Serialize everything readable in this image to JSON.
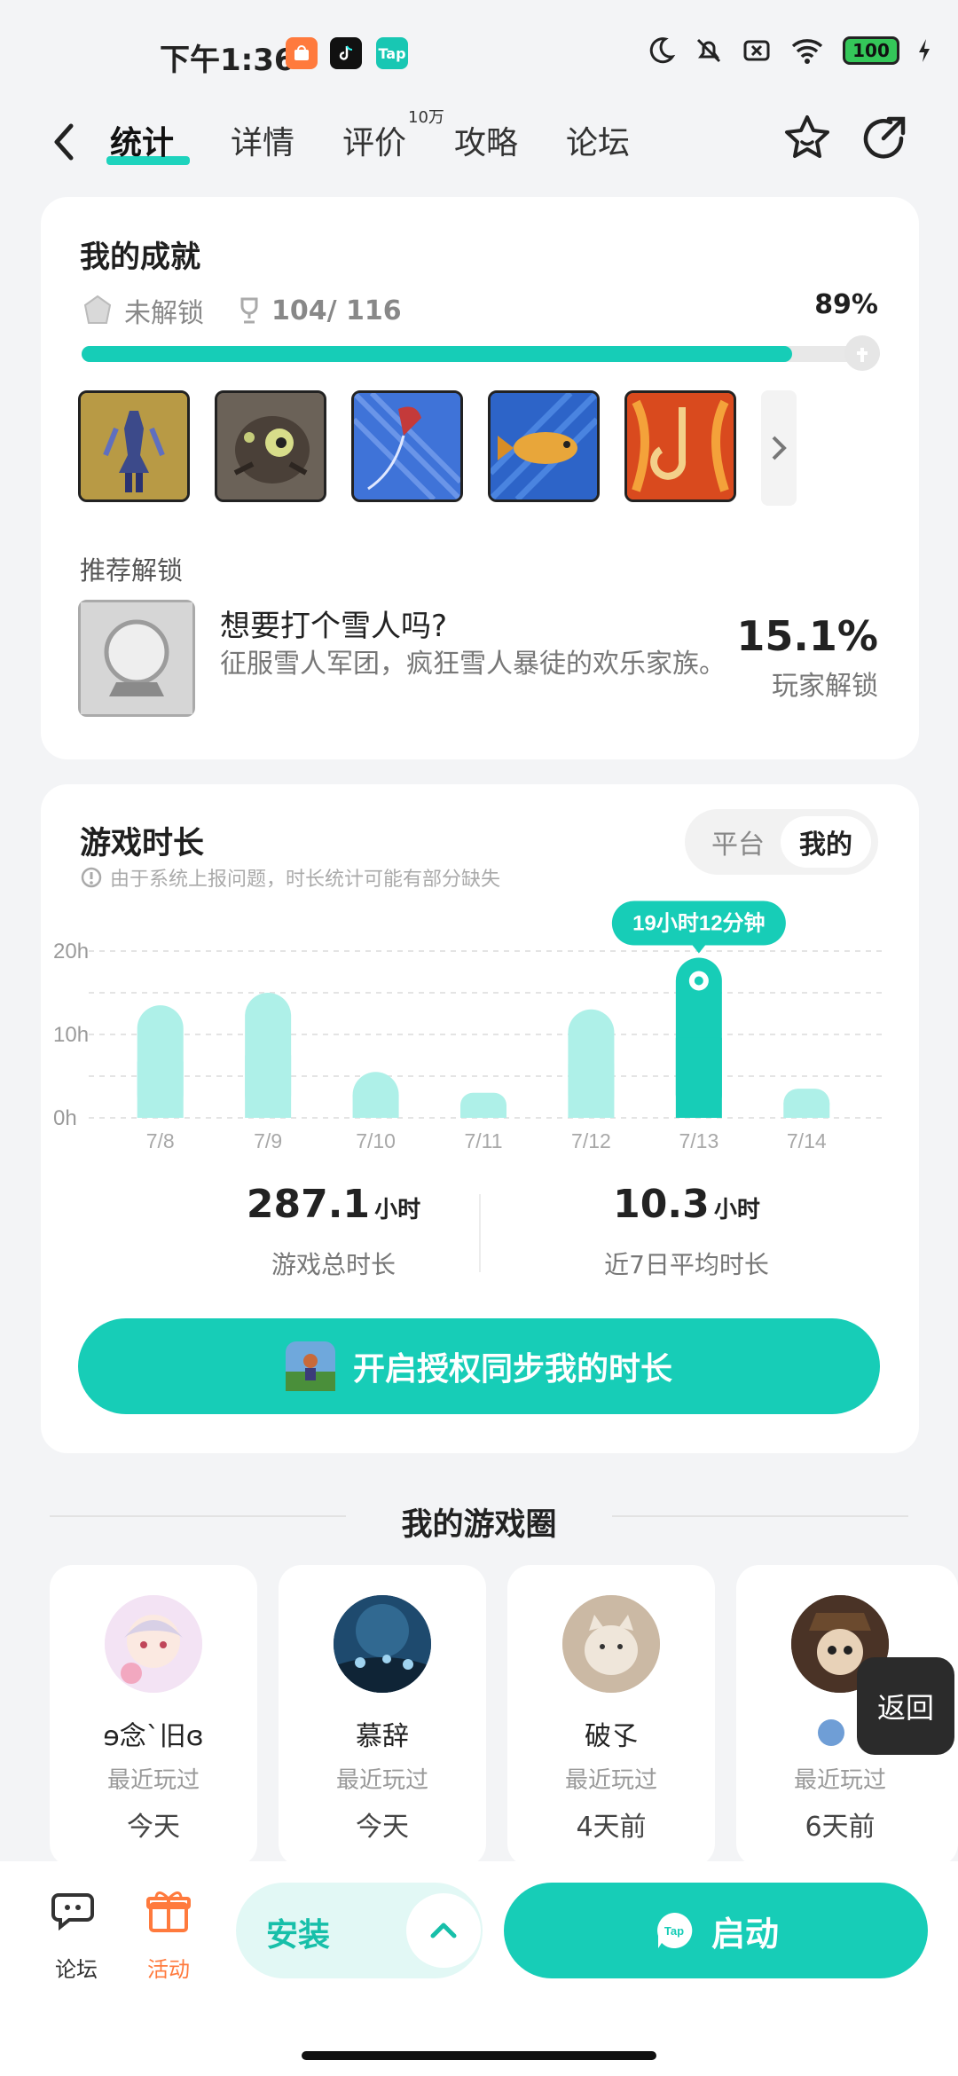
{
  "status": {
    "time": "下午1:36",
    "battery": "100",
    "app_tap": "Tap"
  },
  "nav": {
    "tabs": [
      "统计",
      "详情",
      "评价",
      "攻略",
      "论坛"
    ],
    "review_badge": "10万"
  },
  "achievements": {
    "title": "我的成就",
    "locked_label": "未解锁",
    "count": "104/ 116",
    "percent": "89%",
    "progress_fraction": 0.89,
    "icons": [
      "achievement-armor",
      "achievement-creature",
      "achievement-kite",
      "achievement-fish",
      "achievement-fire-hook"
    ]
  },
  "recommend": {
    "label": "推荐解锁",
    "title": "想要打个雪人吗?",
    "desc": "征服雪人军团，疯狂雪人暴徒的欢乐家族。",
    "pct": "15.1%",
    "pct_label": "玩家解锁"
  },
  "playtime": {
    "title": "游戏时长",
    "note": "由于系统上报问题，时长统计可能有部分缺失",
    "toggle": {
      "platform": "平台",
      "mine": "我的"
    },
    "highlight_label": "19小时12分钟",
    "total_value": "287.1",
    "total_unit": "小时",
    "total_label": "游戏总时长",
    "avg_value": "10.3",
    "avg_unit": "小时",
    "avg_label": "近7日平均时长",
    "sync_button": "开启授权同步我的时长"
  },
  "chart_data": {
    "type": "bar",
    "categories": [
      "7/8",
      "7/9",
      "7/10",
      "7/11",
      "7/12",
      "7/13",
      "7/14"
    ],
    "values": [
      13.5,
      15,
      5.5,
      3,
      13,
      19.2,
      3.5
    ],
    "highlight_index": 5,
    "y_ticks": [
      "0h",
      "10h",
      "20h"
    ],
    "ylim": [
      0,
      20
    ],
    "grid": true
  },
  "circle": {
    "title": "我的游戏圈",
    "friends": [
      {
        "name": "ɘ念ˋ旧ɞ",
        "last": "最近玩过",
        "when": "今天"
      },
      {
        "name": "慕辞",
        "last": "最近玩过",
        "when": "今天"
      },
      {
        "name": "破孓",
        "last": "最近玩过",
        "when": "4天前"
      },
      {
        "name": "",
        "last": "最近玩过",
        "when": "6天前"
      }
    ],
    "return": "返回"
  },
  "bottom": {
    "forum": "论坛",
    "activity": "活动",
    "install": "安装",
    "launch": "启动"
  },
  "colors": {
    "accent": "#17cdb7",
    "bar": "#aef0e8",
    "activity": "#ff7a3d"
  }
}
